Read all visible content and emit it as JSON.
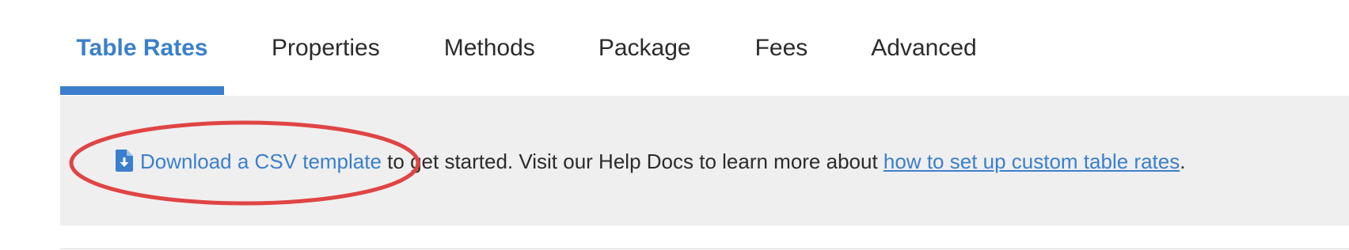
{
  "tabs": [
    {
      "label": "Table Rates",
      "active": true
    },
    {
      "label": "Properties",
      "active": false
    },
    {
      "label": "Methods",
      "active": false
    },
    {
      "label": "Package",
      "active": false
    },
    {
      "label": "Fees",
      "active": false
    },
    {
      "label": "Advanced",
      "active": false
    }
  ],
  "notice": {
    "icon": "file-download-icon",
    "download_link": "Download a CSV template",
    "text_middle": " to get started. Visit our Help Docs to learn more about ",
    "help_link": "how to set up custom table rates",
    "text_end": "."
  },
  "colors": {
    "accent": "#3b7fcc",
    "text": "#2b2b2b",
    "panel_bg": "#efefef",
    "annotation": "#e04444"
  }
}
